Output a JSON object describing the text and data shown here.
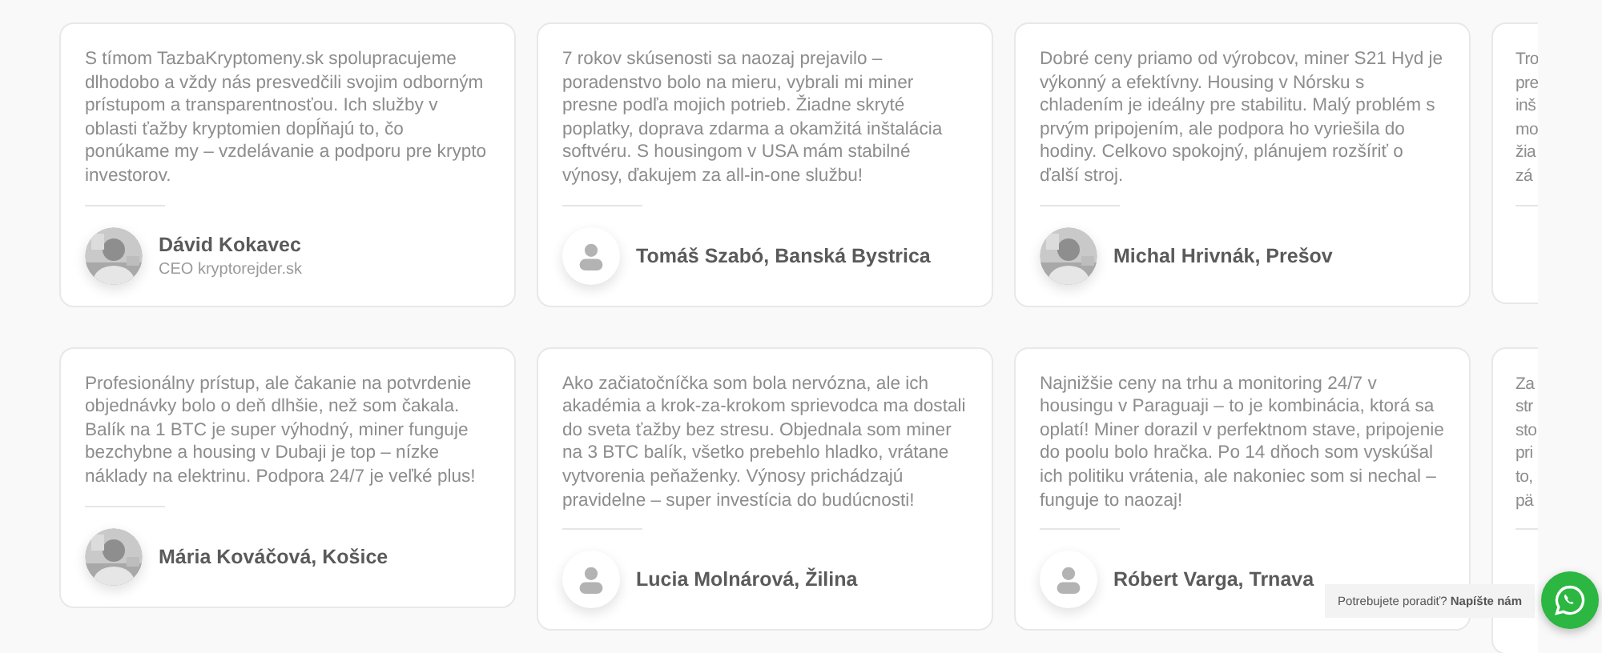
{
  "rows": [
    {
      "cards": [
        {
          "text": "S tímom TazbaKryptomeny.sk spolupracujeme dlhodobo a vždy nás presvedčili svojim odborným prístupom a transparentnosťou. Ich služby v oblasti ťažby kryptomien dopĺňajú to, čo ponúkame my – vzdelávanie a podporu pre krypto investorov.",
          "name": "Dávid Kokavec",
          "role": "CEO kryptorejder.sk"
        },
        {
          "text": "7 rokov skúsenosti sa naozaj prejavilo – poradenstvo bolo na mieru, vybrali mi miner presne podľa mojich potrieb. Žiadne skryté poplatky, doprava zdarma a okamžitá inštalácia softvéru. S housingom v USA mám stabilné výnosy, ďakujem za all-in-one službu!",
          "name": "Tomáš Szabó, Banská Bystrica",
          "kind": "placeholder"
        },
        {
          "text": "Dobré ceny priamo od výrobcov, miner S21 Hyd je výkonný a efektívny. Housing v Nórsku s chladením je ideálny pre stabilitu. Malý problém s prvým pripojením, ale podpora ho vyriešila do hodiny. Celkovo spokojný, plánujem rozšíriť o ďalší stroj.",
          "name": "Michal Hrivnák, Prešov"
        }
      ],
      "partial": [
        "Tro",
        "pre",
        "inš",
        "mo",
        "žia",
        "zá"
      ]
    },
    {
      "cards": [
        {
          "text": "Profesionálny prístup, ale čakanie na potvrdenie objednávky bolo o deň dlhšie, než som čakala. Balík na 1 BTC je super výhodný, miner funguje bezchybne a housing v Dubaji je top – nízke náklady na elektrinu. Podpora 24/7 je veľké plus!",
          "name": "Mária Kováčová, Košice"
        },
        {
          "text": "Ako začiatočníčka som bola nervózna, ale ich akadémia a krok-za-krokom sprievodca ma dostali do sveta ťažby bez stresu. Objednala som miner na 3 BTC balík, všetko prebehlo hladko, vrátane vytvorenia peňaženky. Výnosy prichádzajú pravidelne – super investícia do budúcnosti!",
          "name": "Lucia Molnárová, Žilina",
          "kind": "placeholder"
        },
        {
          "text": "Najnižšie ceny na trhu a monitoring 24/7 v housingu v Paraguaji – to je kombinácia, ktorá sa oplatí! Miner dorazil v perfektnom stave, pripojenie do poolu bolo hračka. Po 14 dňoch som vyskúšal ich politiku vrátenia, ale nakoniec som si nechal – funguje to naozaj!",
          "name": "Róbert Varga, Trnava",
          "kind": "placeholder"
        }
      ],
      "partial": [
        "Za",
        "str",
        "sto",
        "pri",
        "to,",
        "pä"
      ]
    }
  ],
  "chat_widget": {
    "prompt": "Potrebujete poradiť? **Napíšte nám**"
  }
}
